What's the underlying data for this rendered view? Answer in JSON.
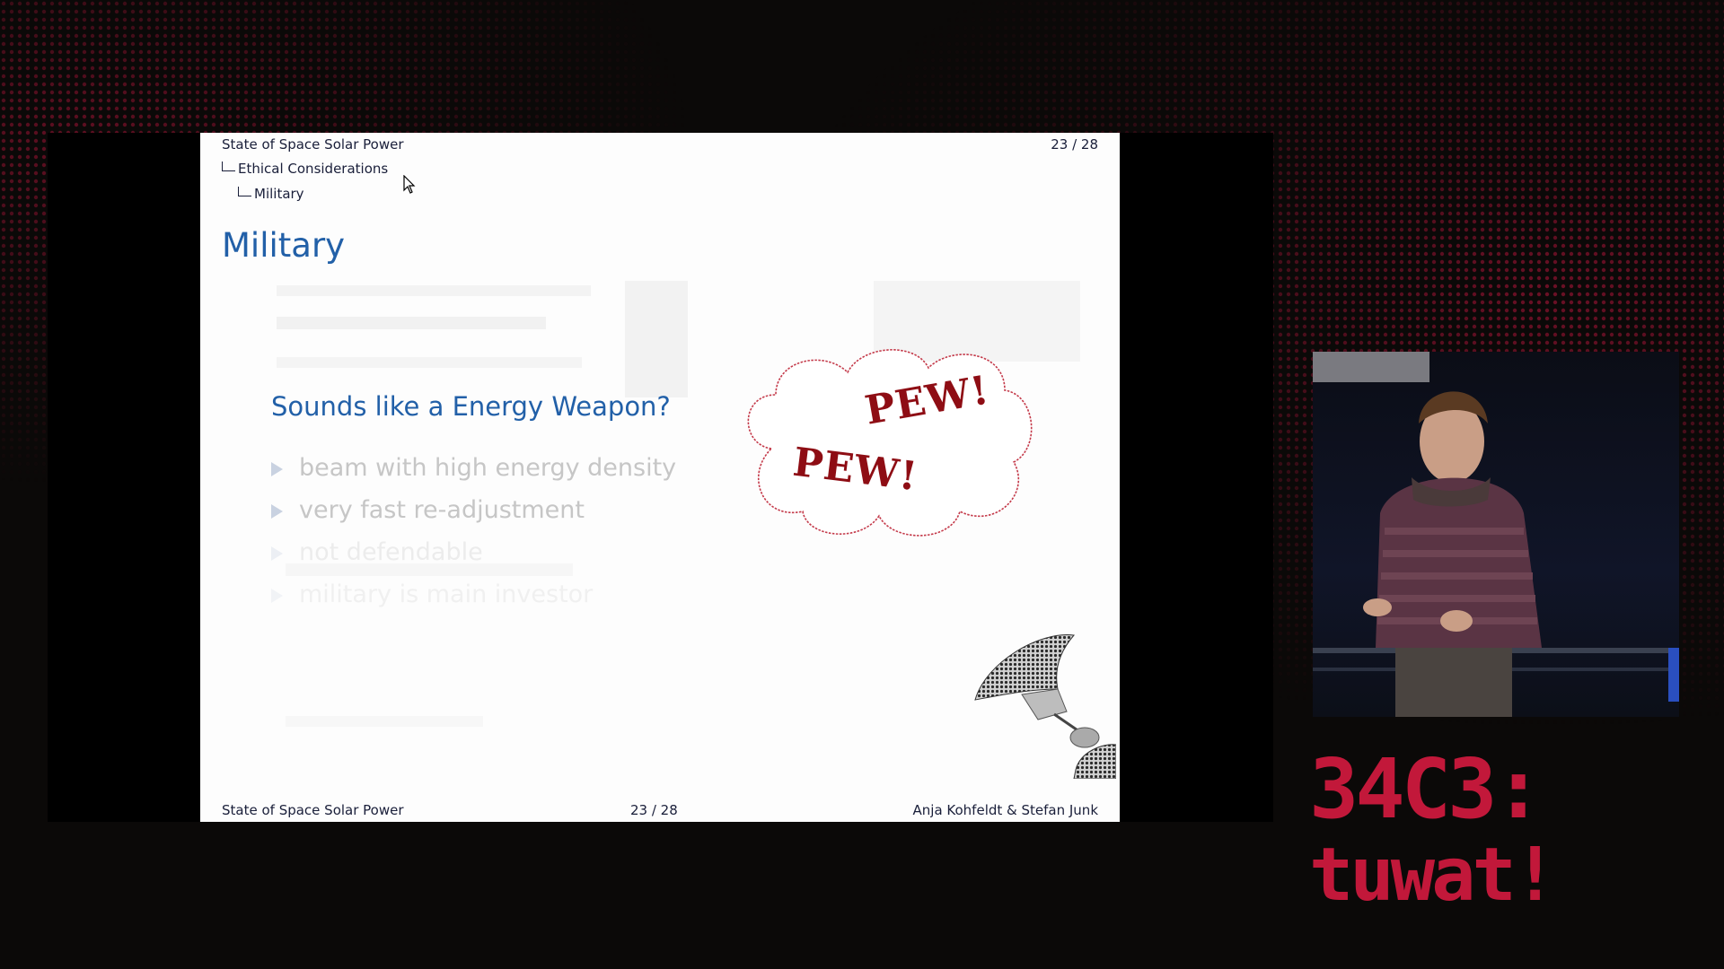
{
  "slide": {
    "header": {
      "title": "State of Space Solar Power",
      "section": "Ethical Considerations",
      "subsection": "Military",
      "page": "23 / 28"
    },
    "frame_title": "Military",
    "question": "Sounds like a Energy Weapon?",
    "bullets": [
      "beam with high energy density",
      "very fast re-adjustment",
      "not defendable",
      "military is main investor"
    ],
    "cloud_text": [
      "PEW!",
      "PEW!"
    ],
    "footer": {
      "left": "State of Space Solar Power",
      "center": "23 / 28",
      "right": "Anja Kohfeldt & Stefan Junk"
    }
  },
  "event_logo": {
    "line1": "34C3:",
    "line2": "tuwat!"
  },
  "colors": {
    "slide_bg": "#fdfdfd",
    "beamer_blue": "#2260a8",
    "pew_red": "#8e0d14",
    "logo_red": "#c2183a",
    "page_bg": "#0b0908"
  }
}
